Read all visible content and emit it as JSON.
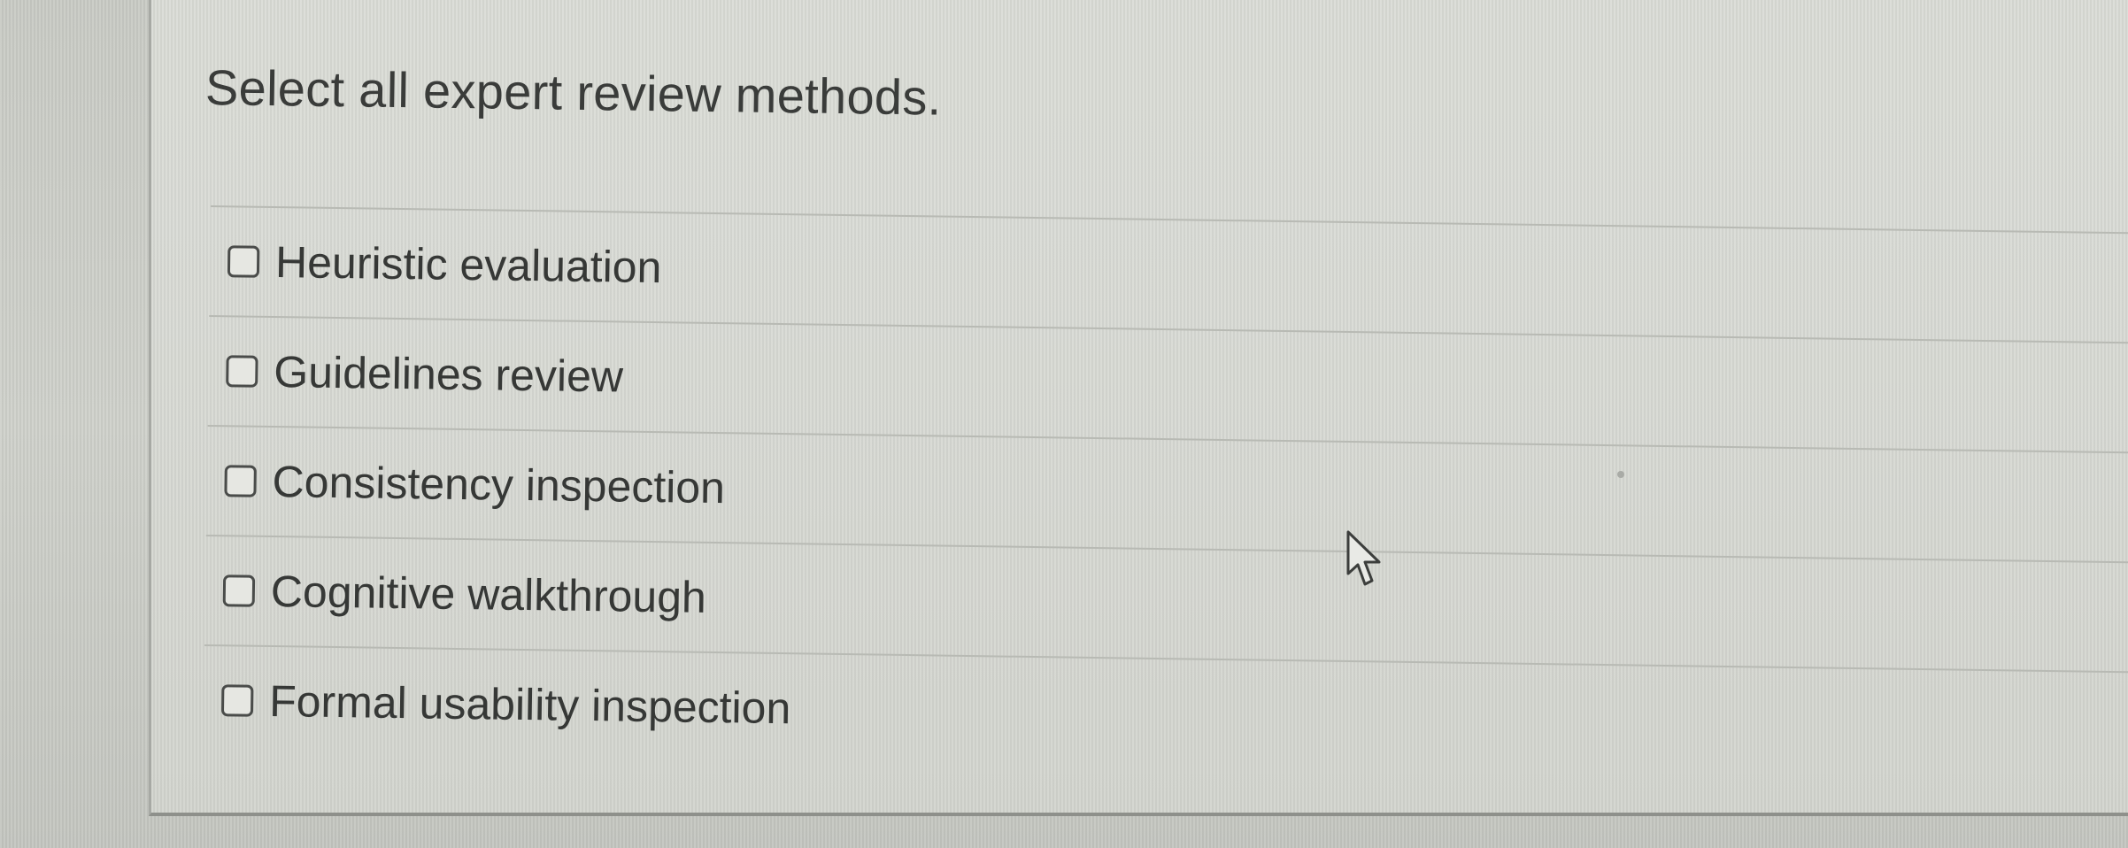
{
  "question": {
    "text": "Select all expert review methods."
  },
  "options": [
    {
      "label": "Heuristic evaluation",
      "checked": false
    },
    {
      "label": "Guidelines review",
      "checked": false
    },
    {
      "label": "Consistency inspection",
      "checked": false
    },
    {
      "label": "Cognitive walkthrough",
      "checked": false
    },
    {
      "label": "Formal usability inspection",
      "checked": false
    }
  ],
  "icons": {
    "cursor": "mouse-pointer-icon",
    "checkbox": "checkbox-unchecked-icon"
  },
  "colors": {
    "text": "#363836",
    "checkbox_border": "#4a4c4a",
    "background": "#d8dad4"
  }
}
